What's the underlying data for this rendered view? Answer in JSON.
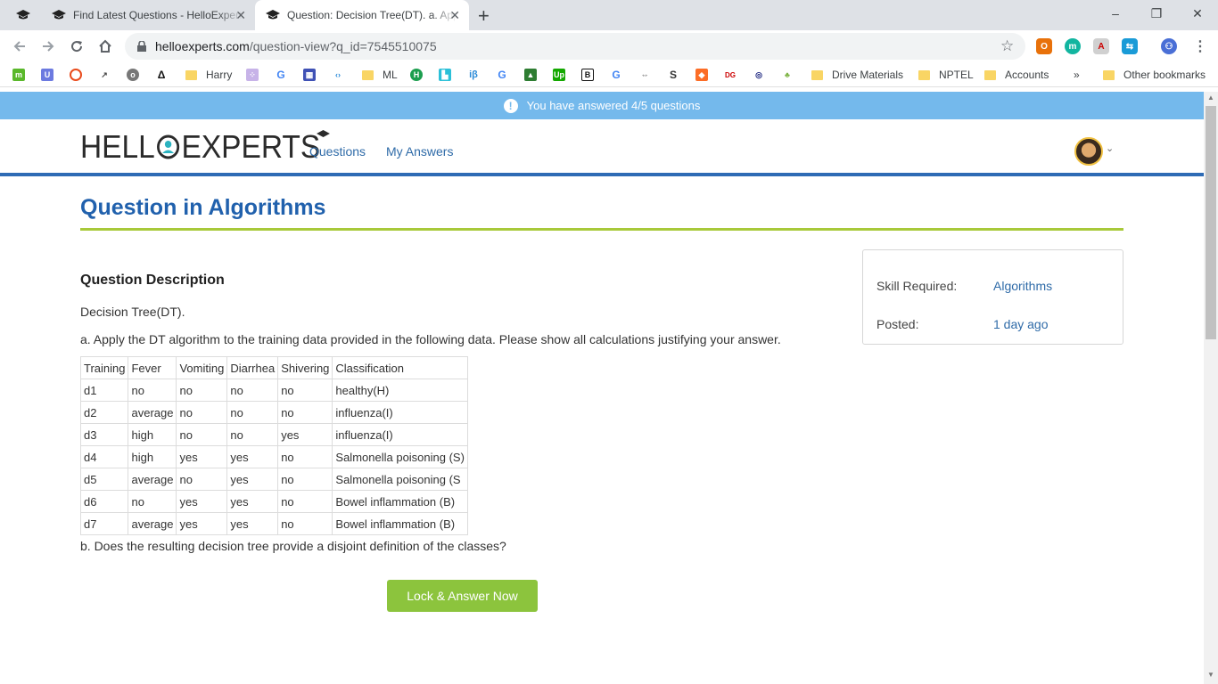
{
  "browser": {
    "tabs": [
      {
        "title": "Find Latest Questions - HelloExperts",
        "close": "✕"
      },
      {
        "title": "Question: Decision Tree(DT). a. Apply",
        "close": "✕",
        "active": true
      }
    ],
    "new_tab": "+",
    "window_controls": {
      "minimize": "–",
      "restore": "❐",
      "close": "✕"
    },
    "url_host": "helloexperts.com",
    "url_path": "/question-view?q_id=7545510075",
    "bookmarks": [
      {
        "label": "Harry",
        "type": "folder"
      },
      {
        "label": "ML",
        "type": "folder"
      },
      {
        "label": "Drive Materials",
        "type": "folder"
      },
      {
        "label": "NPTEL",
        "type": "folder"
      },
      {
        "label": "Accounts",
        "type": "folder"
      }
    ],
    "bookmarks_overflow": "»",
    "other_bookmarks": "Other bookmarks"
  },
  "notice": {
    "text": "You have answered 4/5 questions",
    "icon": "exclamation-icon"
  },
  "header": {
    "logo_left": "HELL",
    "logo_right": "EXPERTS",
    "nav": [
      "Questions",
      "My Answers"
    ]
  },
  "page": {
    "title": "Question in Algorithms",
    "description_heading": "Question Description",
    "intro": "Decision Tree(DT).",
    "part_a": "a. Apply the DT algorithm to the training data provided in the following data. Please show all calculations justifying your answer.",
    "part_b": "b.   Does the resulting decision tree provide a disjoint definition of the classes?",
    "table": {
      "headers": [
        "Training",
        "Fever",
        "Vomiting",
        "Diarrhea",
        "Shivering",
        "Classification"
      ],
      "rows": [
        [
          "d1",
          "no",
          "no",
          "no",
          "no",
          "healthy(H)"
        ],
        [
          "d2",
          "average",
          "no",
          "no",
          "no",
          "influenza(I)"
        ],
        [
          "d3",
          "high",
          "no",
          "no",
          "yes",
          "influenza(I)"
        ],
        [
          "d4",
          "high",
          "yes",
          "yes",
          "no",
          "Salmonella poisoning (S)"
        ],
        [
          "d5",
          "average",
          "no",
          "yes",
          "no",
          "Salmonella poisoning (S"
        ],
        [
          "d6",
          "no",
          "yes",
          "yes",
          "no",
          "Bowel inflammation (B)"
        ],
        [
          "d7",
          "average",
          "yes",
          "yes",
          "no",
          "Bowel inflammation (B)"
        ]
      ]
    },
    "button": "Lock & Answer Now"
  },
  "info": {
    "skill_label": "Skill Required:",
    "skill_value": "Algorithms",
    "posted_label": "Posted:",
    "posted_value": "1 day ago"
  },
  "colors": {
    "brand_blue": "#2161ad",
    "accent_green": "#8cc43d",
    "notice_blue": "#74b9ec"
  }
}
